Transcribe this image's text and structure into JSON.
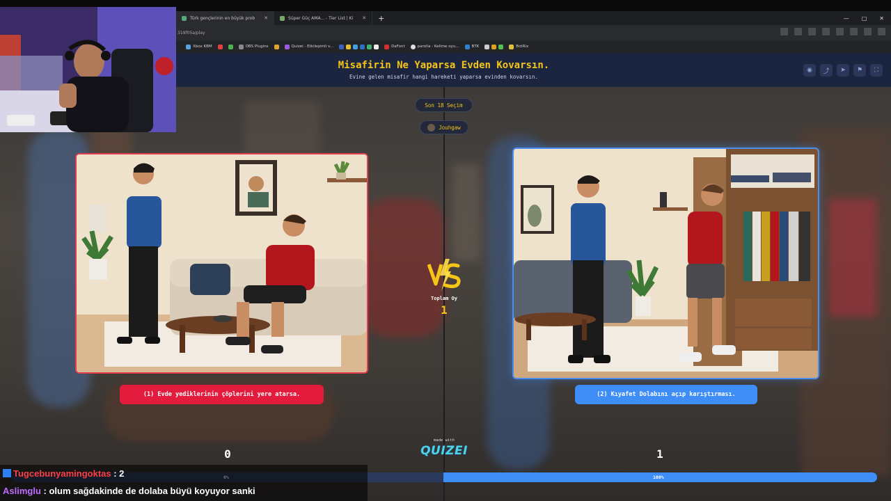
{
  "browser": {
    "tabs": [
      {
        "label": "Türk gençlerinin en büyük prob"
      },
      {
        "label": "Süper Güç AMA... - Tier List | Ki"
      }
    ],
    "new_tab": "+",
    "url": "319f05a/play",
    "bookmarks": [
      "Xbox KBM",
      "OBS Plugins",
      "Quizei - Etkileşimli v...",
      "DaFont",
      "parolla - Kelime oyu...",
      "BTK",
      "BotRix"
    ]
  },
  "app": {
    "title": "Misafirin Ne Yaparsa Evden Kovarsın.",
    "subtitle": "Evine gelen misafir hangi hareketi yaparsa evinden kovarsın.",
    "round_chip": "Son 18 Seçim",
    "user_chip": "Jouhgaw",
    "options": [
      {
        "label": "(1) Evde yediklerinin çöplerini yere atarsa.",
        "score": "0",
        "percent": "0%"
      },
      {
        "label": "(2) Kıyafet Dolabını açıp karıştırması.",
        "score": "1",
        "percent": "100%"
      }
    ],
    "total_label": "Toplam Oy",
    "total_value": "1",
    "made_with": "made with",
    "brand": "QUIZEI",
    "progress_fraction": 1.0
  },
  "chat": [
    {
      "user": "Tugcebunyamingoktas",
      "message": " : 2"
    },
    {
      "user": "Aslimglu",
      "message": " : olum sağdakinde de dolaba büyü koyuyor sanki"
    }
  ],
  "colors": {
    "accent_yellow": "#f5c518",
    "red": "#e31b3d",
    "blue": "#3f8ef7",
    "header_bg": "#1b2540"
  }
}
